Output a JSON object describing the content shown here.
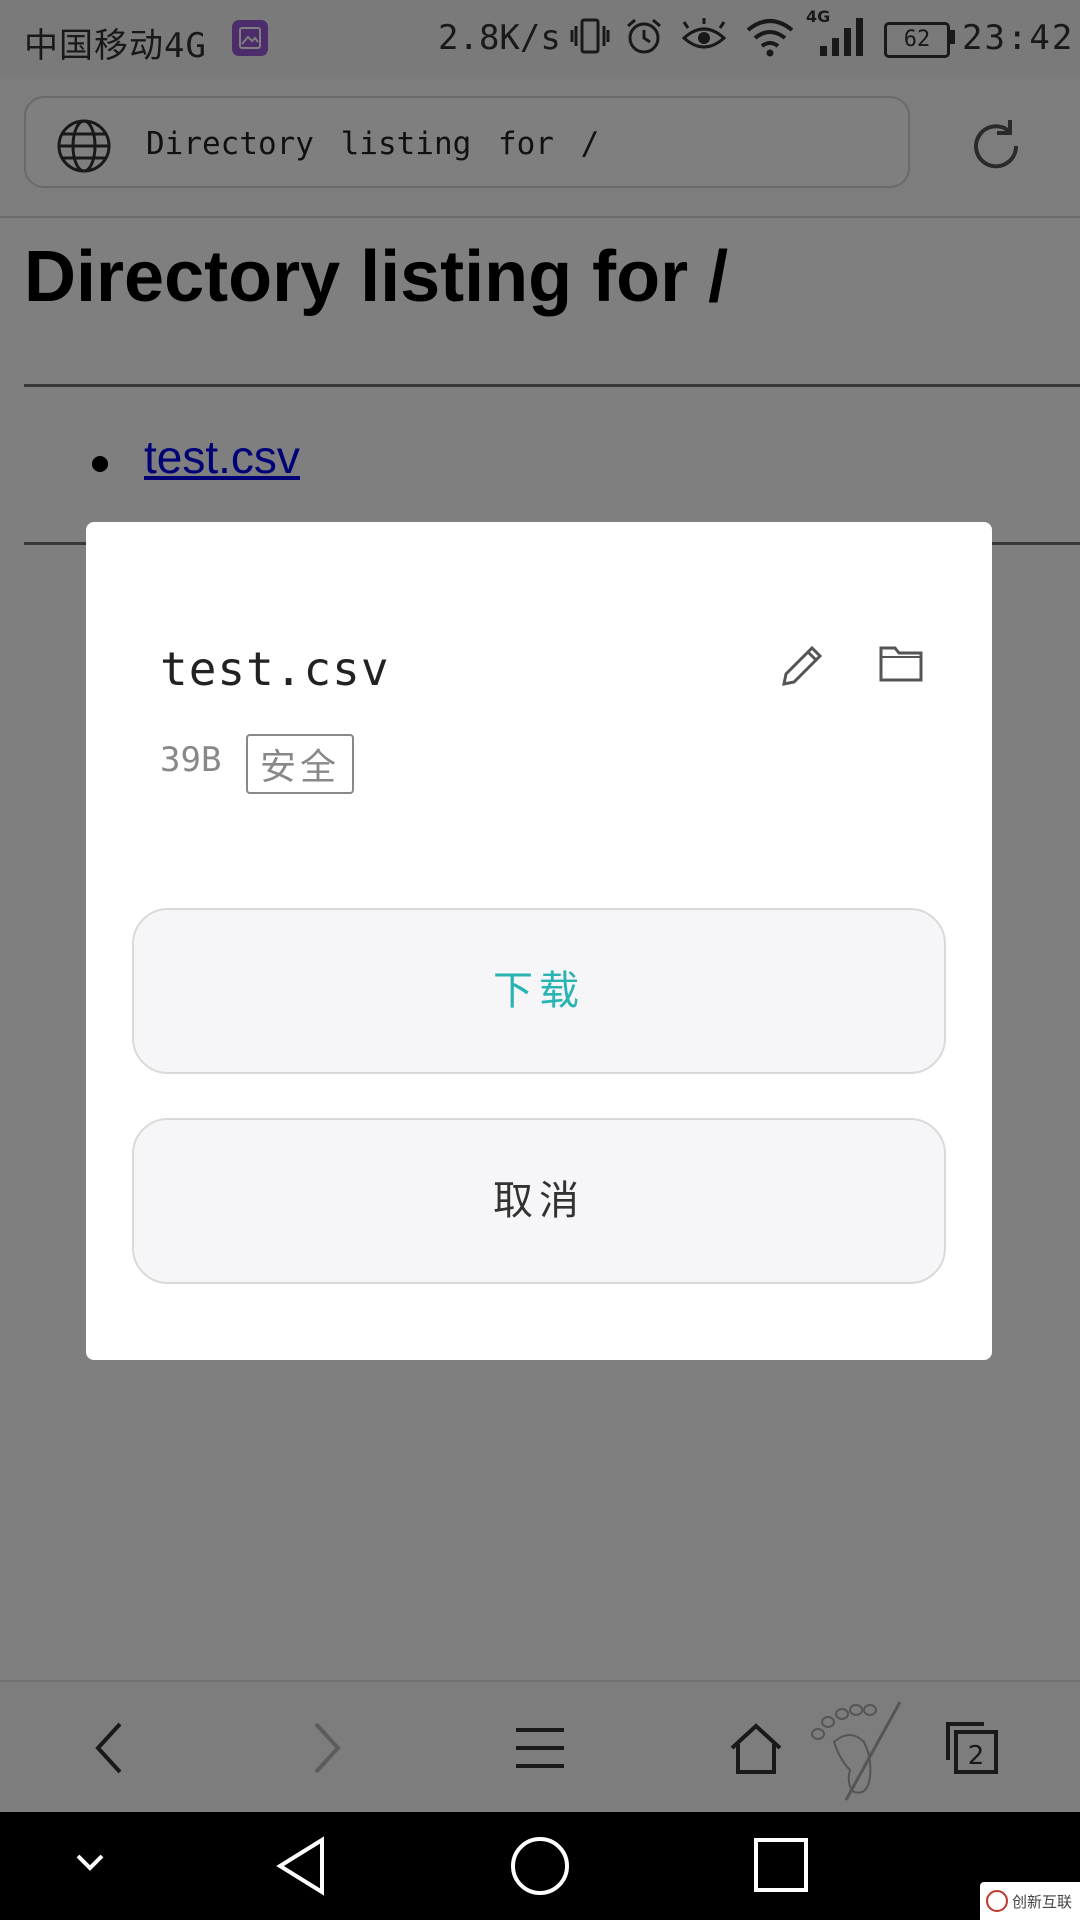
{
  "status_bar": {
    "carrier": "中国移动4G",
    "network_speed": "2.8K/s",
    "battery_level": "62",
    "time": "23:42",
    "icons": [
      "gallery-notification-icon",
      "vibrate-icon",
      "alarm-icon",
      "eye-comfort-icon",
      "wifi-icon",
      "signal-4g-icon"
    ],
    "gallery_badge_color": "#9b59d6"
  },
  "address_bar": {
    "url_text": "Directory listing for /",
    "left_icon": "globe-icon",
    "right_icon": "reload-icon"
  },
  "page": {
    "title": "Directory listing for /",
    "files": [
      {
        "name": "test.csv"
      }
    ],
    "link_color": "#0000ee"
  },
  "dialog": {
    "file_name": "test.csv",
    "file_size": "39B",
    "safety_badge": "安全",
    "edit_icon": "pencil-icon",
    "folder_icon": "folder-icon",
    "download_label": "下载",
    "cancel_label": "取消",
    "download_color": "#2ab3b3"
  },
  "browser_toolbar": {
    "buttons": [
      "back-icon",
      "forward-icon",
      "menu-icon",
      "home-icon",
      "tabs-icon"
    ],
    "tab_count": "2"
  },
  "system_nav": {
    "buttons": [
      "hide-keyboard-icon",
      "system-back-icon",
      "system-home-icon",
      "recent-apps-icon"
    ]
  },
  "watermark": {
    "text": "创新互联"
  }
}
